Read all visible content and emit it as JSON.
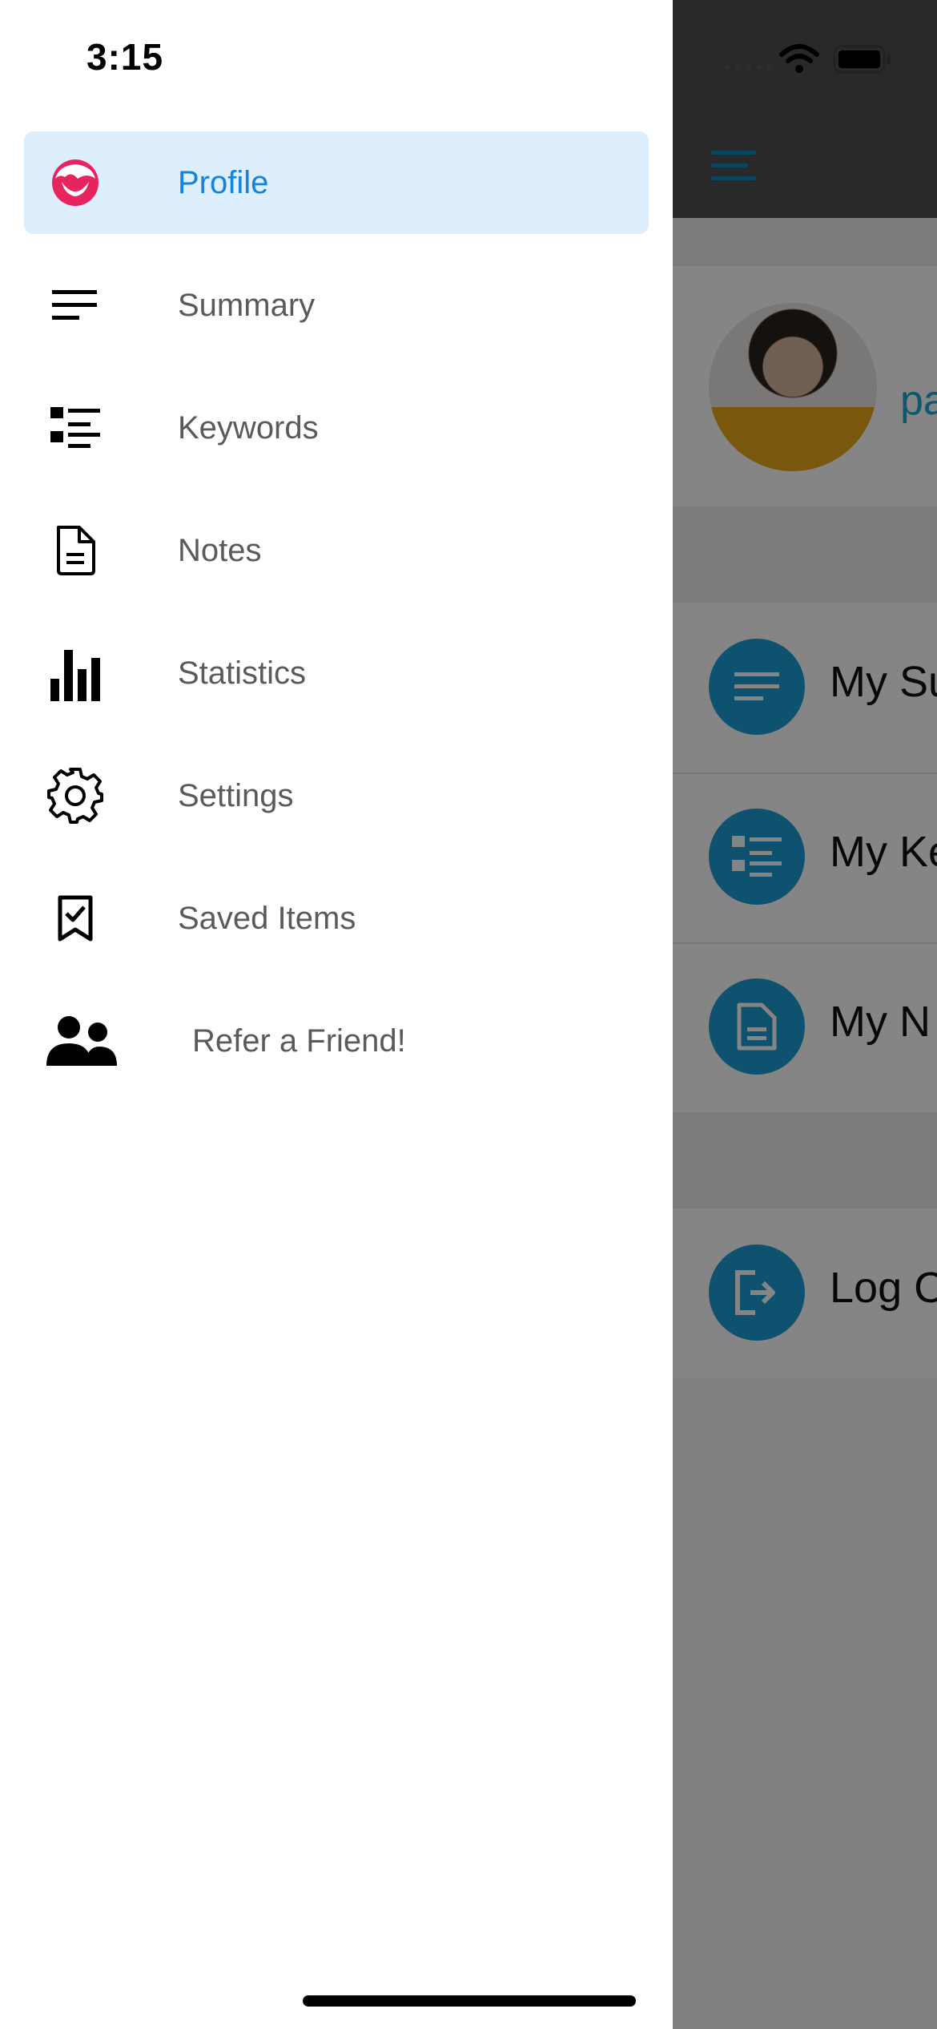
{
  "status_bar": {
    "time": "3:15"
  },
  "drawer": {
    "items": [
      {
        "label": "Profile",
        "icon": "profile-face-icon",
        "active": true
      },
      {
        "label": "Summary",
        "icon": "summary-lines-icon"
      },
      {
        "label": "Keywords",
        "icon": "keywords-list-icon"
      },
      {
        "label": "Notes",
        "icon": "notes-document-icon"
      },
      {
        "label": "Statistics",
        "icon": "bar-chart-icon"
      },
      {
        "label": "Settings",
        "icon": "gear-icon"
      },
      {
        "label": "Saved Items",
        "icon": "bookmark-check-icon"
      },
      {
        "label": "Refer a Friend!",
        "icon": "people-icon"
      }
    ]
  },
  "background_screen": {
    "username_partial": "pa",
    "rows": [
      {
        "label": "My Su",
        "icon": "summary-lines-icon"
      },
      {
        "label": "My Ke",
        "icon": "keywords-list-icon"
      },
      {
        "label": "My N",
        "icon": "notes-document-icon"
      },
      {
        "label": "Log C",
        "icon": "logout-icon"
      }
    ]
  },
  "colors": {
    "active_bg": "#ddeefc",
    "active_text": "#1682d9",
    "profile_icon": "#e8245e",
    "accent_blue": "#1b9ed6"
  }
}
